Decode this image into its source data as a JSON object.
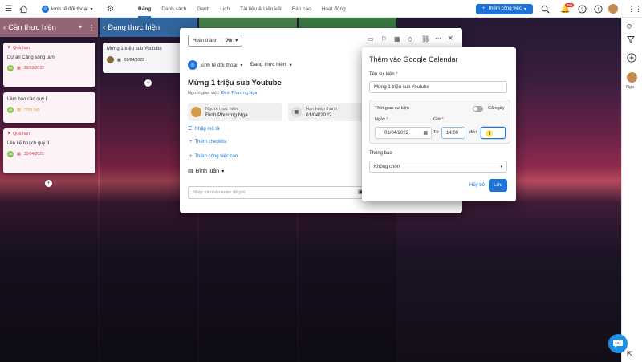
{
  "topbar": {
    "project_name": "kinh tế đối thoại",
    "tabs": [
      {
        "label": "Bảng",
        "active": true
      },
      {
        "label": "Danh sách",
        "active": false
      },
      {
        "label": "Gantt",
        "active": false
      },
      {
        "label": "Lịch",
        "active": false
      },
      {
        "label": "Tài liệu & Liên kết",
        "active": false
      },
      {
        "label": "Báo cáo",
        "active": false
      },
      {
        "label": "Hoạt động",
        "active": false
      }
    ],
    "add_task_label": "Thêm công việc",
    "notif_count": "99+",
    "accent": "#1e73d6"
  },
  "rail": {
    "user_name": "Nga"
  },
  "columns": [
    {
      "title": "Cần thực hiện",
      "color": "#f2a8b4"
    },
    {
      "title": "Đang thực hiện",
      "color": "#3d9be9"
    },
    {
      "title": "",
      "color": "#5cb85c"
    },
    {
      "title": "",
      "color": "#4caf50"
    }
  ],
  "cards_todo": [
    {
      "tag": "Quá hạn",
      "title": "Dự án Cảng sông lam",
      "date": "25/03/2022",
      "avatar": "AN"
    },
    {
      "tag": "",
      "title": "Làm báo cáo quý I",
      "date": "Hôm nay",
      "avatar": "AN"
    },
    {
      "tag": "Quá hạn",
      "title": "Lên kế hoạch quý II",
      "date": "30/04/2021",
      "avatar": "AN"
    }
  ],
  "cards_doing": [
    {
      "title": "Mừng 1 triệu sub Youtube",
      "date": "01/04/2022"
    }
  ],
  "task": {
    "status_label": "Hoàn thành",
    "progress": "0%",
    "project": "kinh tế đối thoại",
    "stage": "Đang thực hiện",
    "title": "Mừng 1 triệu sub Youtube",
    "assigner_prefix": "Người giao việc:",
    "assigner": "Đinh Phương Nga",
    "assignee_label": "Người thực hiện",
    "assignee": "Đinh Phương Nga",
    "deadline_label": "Hạn hoàn thành",
    "deadline": "01/04/2022",
    "add_desc": "Nhập mô tả",
    "add_checklist": "Thêm checklist",
    "add_subtask": "Thêm công việc con",
    "comments_label": "Bình luận",
    "comment_placeholder": "Nhập và nhấn enter để gửi"
  },
  "calendar": {
    "title": "Thêm vào Google Calendar",
    "event_name_label": "Tên sự kiện",
    "event_name_value": "Mừng 1 triệu sub Youtube",
    "event_time_label": "Thời gian sự kiện",
    "all_day_label": "Cả ngày",
    "date_label": "Ngày",
    "date_value": "01/04/2022",
    "hour_label": "Giờ",
    "from_label": "Từ",
    "from_value": "14:00",
    "to_label": "đến",
    "to_value": "",
    "notify_label": "Thông báo",
    "notify_value": "Không chọn",
    "cancel_label": "Hủy bỏ",
    "save_label": "Lưu"
  }
}
